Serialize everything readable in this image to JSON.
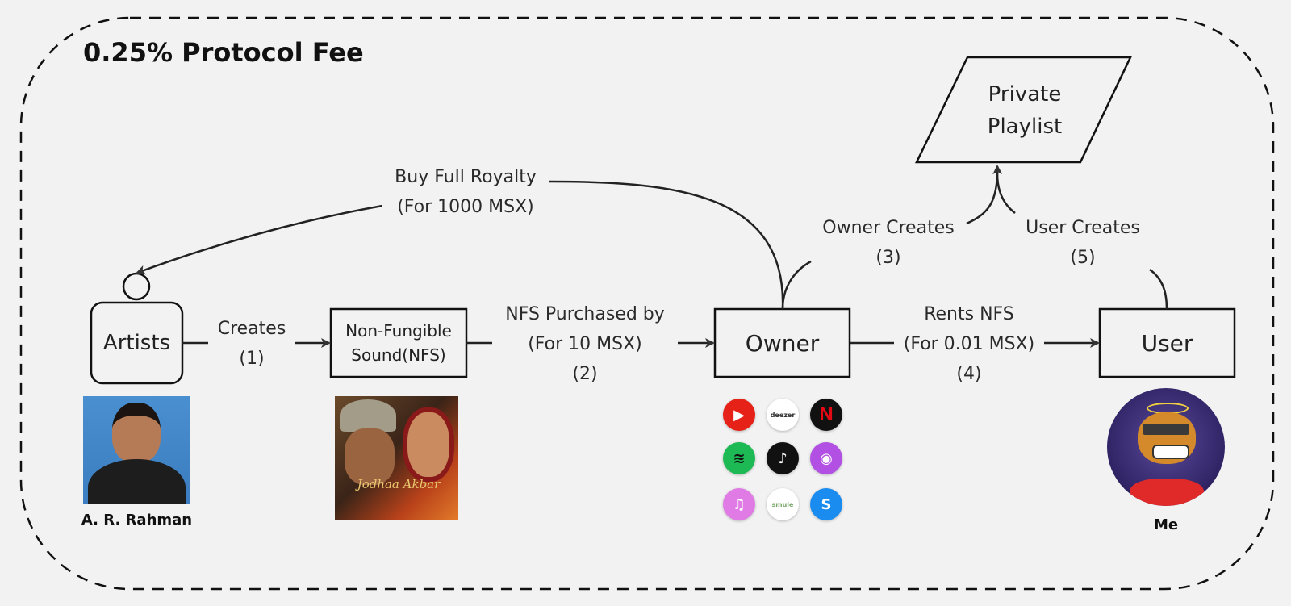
{
  "title": "0.25% Protocol Fee",
  "nodes": {
    "artists": "Artists",
    "nfs": {
      "line1": "Non-Fungible",
      "line2": "Sound(NFS)"
    },
    "owner": "Owner",
    "user": "User",
    "playlist": {
      "line1": "Private",
      "line2": "Playlist"
    }
  },
  "edges": {
    "creates": {
      "line1": "Creates",
      "line2": "(1)"
    },
    "purchase": {
      "line1": "NFS Purchased by",
      "line2": "(For 10 MSX)",
      "line3": "(2)"
    },
    "owner_creates": {
      "line1": "Owner Creates",
      "line2": "(3)"
    },
    "rents": {
      "line1": "Rents NFS",
      "line2": "(For 0.01 MSX)",
      "line3": "(4)"
    },
    "user_creates": {
      "line1": "User Creates",
      "line2": "(5)"
    },
    "royalty": {
      "line1": "Buy Full Royalty",
      "line2": "(For 1000 MSX)"
    }
  },
  "captions": {
    "artist_photo": "A. R. Rahman",
    "album_cover_title": "Jodhaa Akbar",
    "user_avatar": "Me"
  },
  "platforms": [
    {
      "name": "youtube",
      "bg": "#e62117",
      "fg": "#ffffff",
      "glyph": "▶"
    },
    {
      "name": "deezer",
      "bg": "#ffffff",
      "fg": "#333333",
      "glyph": "deezer"
    },
    {
      "name": "netflix",
      "bg": "#111111",
      "fg": "#e50914",
      "glyph": "N"
    },
    {
      "name": "spotify",
      "bg": "#1db954",
      "fg": "#111111",
      "glyph": "≋"
    },
    {
      "name": "tiktok",
      "bg": "#111111",
      "fg": "#ffffff",
      "glyph": "♪"
    },
    {
      "name": "apple-podcasts",
      "bg": "#b150e2",
      "fg": "#ffffff",
      "glyph": "◉"
    },
    {
      "name": "itunes",
      "bg": "#e07be6",
      "fg": "#ffffff",
      "glyph": "♫"
    },
    {
      "name": "smule",
      "bg": "#ffffff",
      "fg": "#7aa86a",
      "glyph": "smule"
    },
    {
      "name": "shazam",
      "bg": "#1a8cf0",
      "fg": "#ffffff",
      "glyph": "S"
    }
  ]
}
